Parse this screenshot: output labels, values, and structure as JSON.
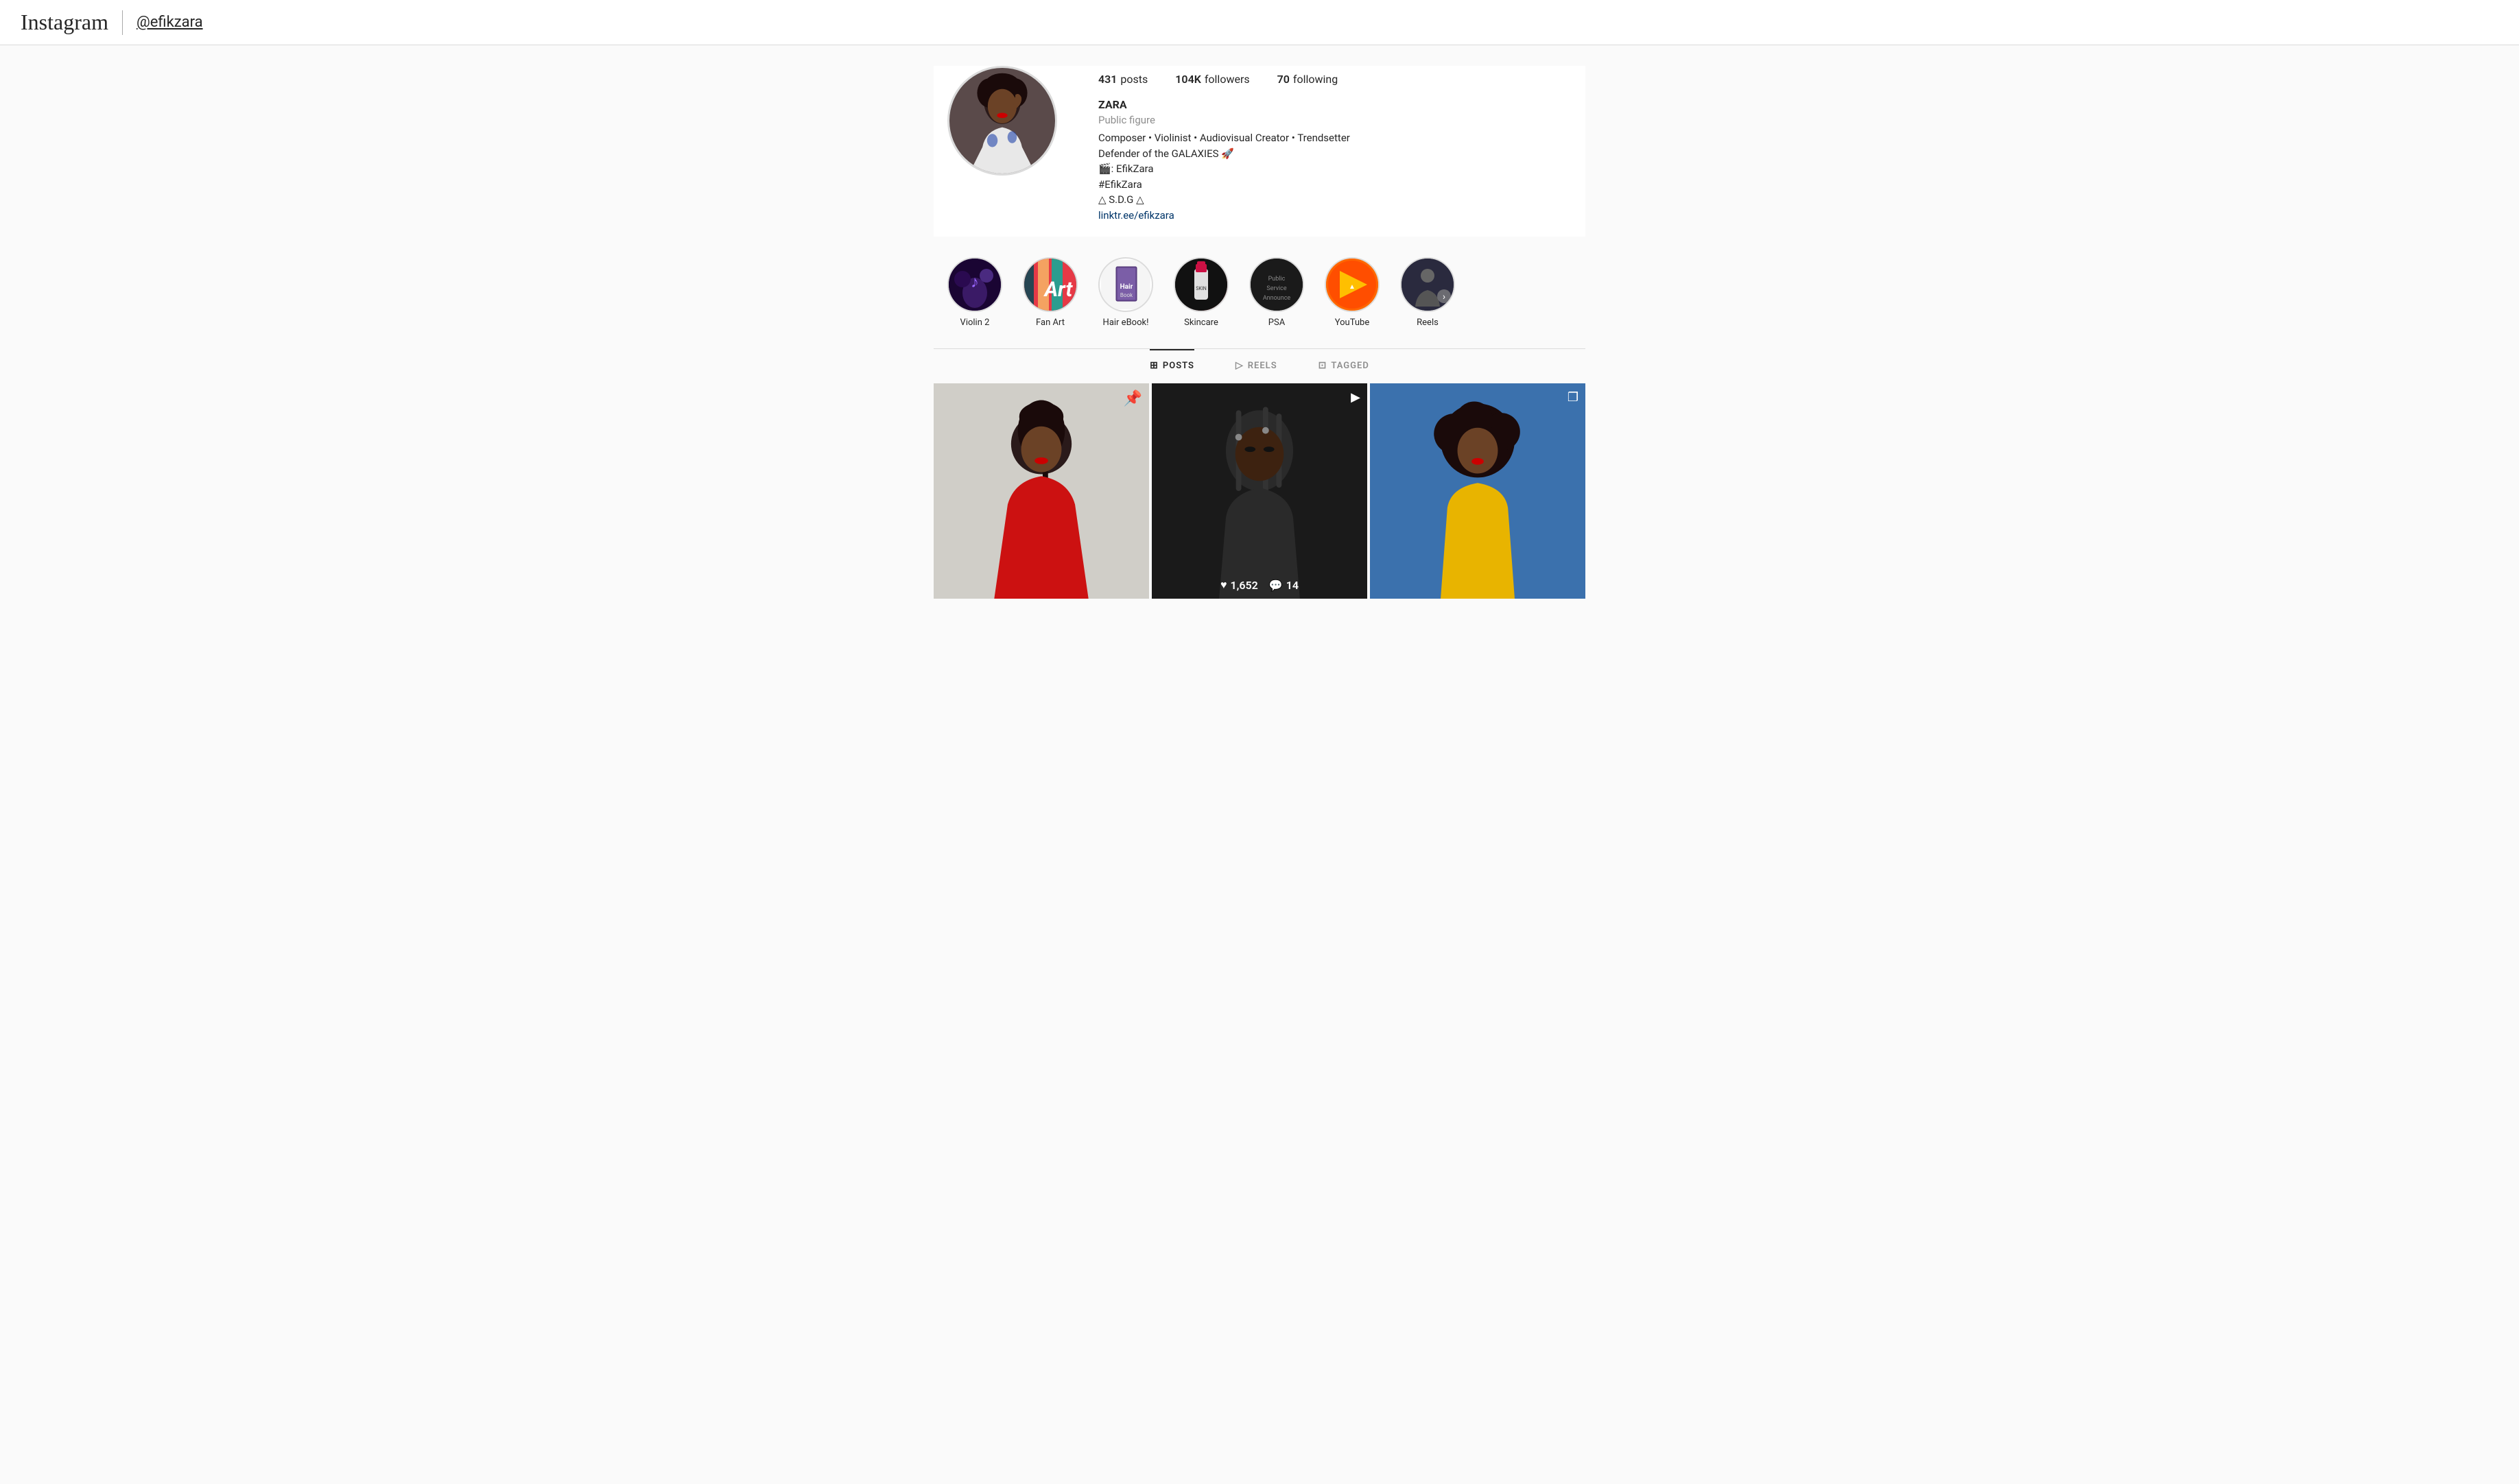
{
  "header": {
    "logo": "Instagram",
    "divider": true,
    "handle": "@efikzara"
  },
  "profile": {
    "stats": [
      {
        "count": "431",
        "label": "posts"
      },
      {
        "count": "104K",
        "label": "followers"
      },
      {
        "count": "70",
        "label": "following"
      }
    ],
    "name": "ZARA",
    "category": "Public figure",
    "bio_line1": "Composer • Violinist • Audiovisual Creator • Trendsetter",
    "bio_line2": "Defender of the GALAXIES 🚀",
    "bio_line3": "🎬: EfikZara",
    "bio_line4": "#EfikZara",
    "bio_line5": "△ S.D.G △",
    "bio_link": "linktr.ee/efikzara"
  },
  "highlights": [
    {
      "id": "violin2",
      "label": "Violin 2",
      "css_class": "hl-violin"
    },
    {
      "id": "fanart",
      "label": "Fan Art",
      "css_class": "hl-fanart"
    },
    {
      "id": "hairebook",
      "label": "Hair eBook!",
      "css_class": "hl-hairebook"
    },
    {
      "id": "skincare",
      "label": "Skincare",
      "css_class": "hl-skincare"
    },
    {
      "id": "psa",
      "label": "PSA",
      "css_class": "hl-psa"
    },
    {
      "id": "youtube",
      "label": "YouTube",
      "css_class": "hl-youtube"
    },
    {
      "id": "reels",
      "label": "Reels",
      "css_class": "hl-reels"
    }
  ],
  "tabs": [
    {
      "id": "posts",
      "label": "POSTS",
      "icon": "⊞",
      "active": true
    },
    {
      "id": "reels",
      "label": "REELS",
      "icon": "▷",
      "active": false
    },
    {
      "id": "tagged",
      "label": "TAGGED",
      "icon": "◻",
      "active": false
    }
  ],
  "posts": [
    {
      "id": "post-1",
      "has_icon": true,
      "icon": "📌",
      "has_stats": false,
      "bg": "post-1"
    },
    {
      "id": "post-2",
      "has_icon": true,
      "icon": "▶",
      "has_stats": true,
      "likes": "1,652",
      "comments": "14",
      "bg": "post-2"
    },
    {
      "id": "post-3",
      "has_icon": true,
      "icon": "◫",
      "has_stats": false,
      "bg": "post-3"
    }
  ],
  "icons": {
    "pin": "📌",
    "video": "▶",
    "carousel": "❐",
    "heart": "♥",
    "comment": "💬",
    "grid": "⊞",
    "reel": "⬡",
    "tag": "⊡",
    "next_arrow": "❯"
  }
}
